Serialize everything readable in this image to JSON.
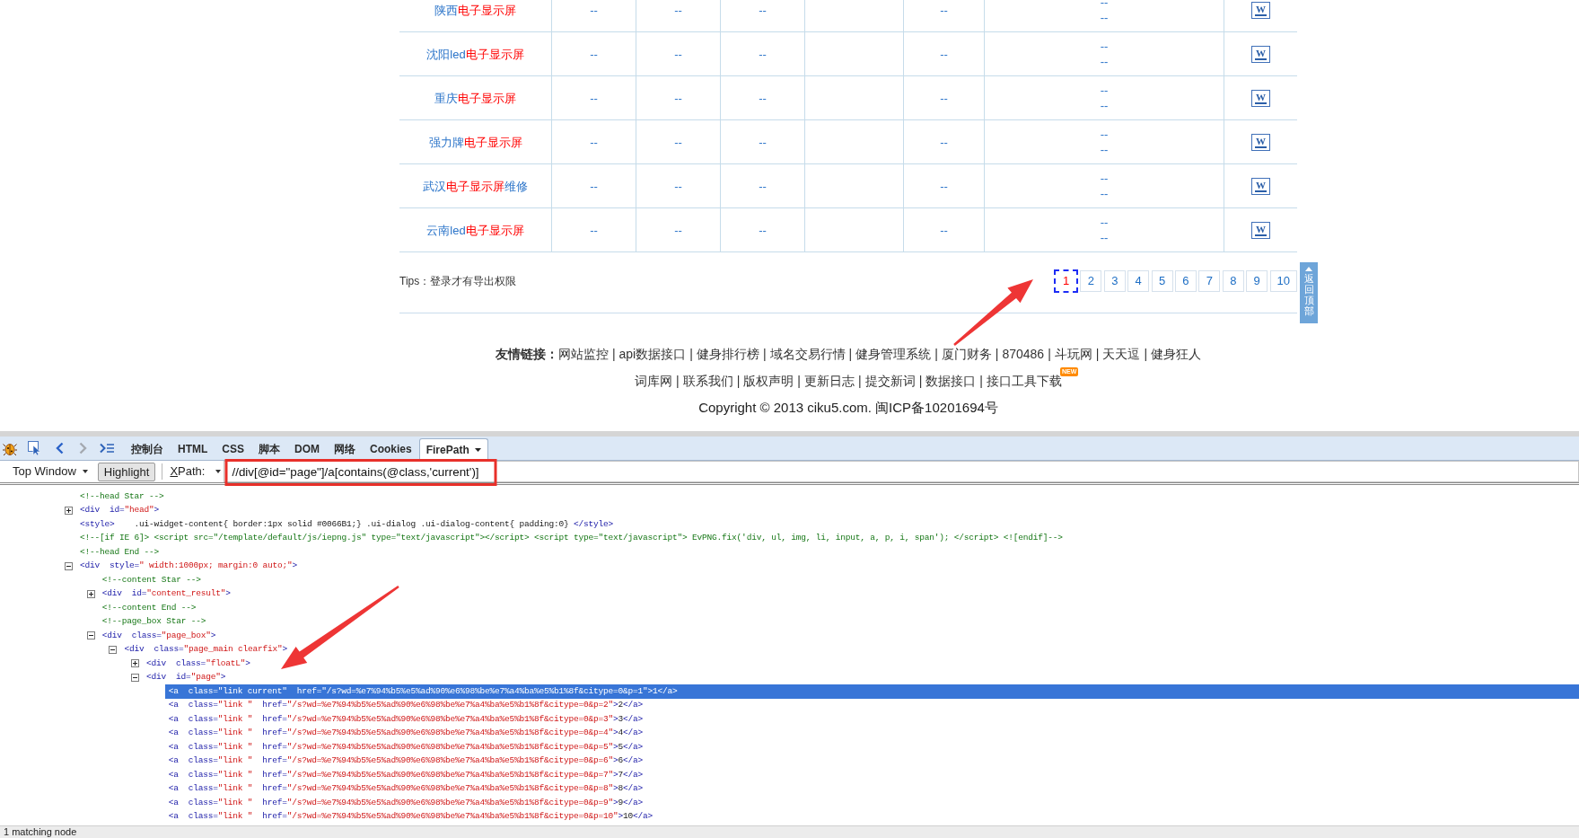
{
  "results_table": {
    "rows": [
      {
        "name": [
          {
            "text": "陕西",
            "highlight": false
          },
          {
            "text": "电子显示屏",
            "highlight": true
          }
        ],
        "column_2": "--",
        "column_3": "--",
        "column_4": "--",
        "column_6": "--",
        "column_7": [
          "--",
          "--"
        ],
        "column_8": "W"
      },
      {
        "name": [
          {
            "text": "沈阳led",
            "highlight": false
          },
          {
            "text": "电子显示屏",
            "highlight": true
          }
        ],
        "column_2": "--",
        "column_3": "--",
        "column_4": "--",
        "column_6": "--",
        "column_7": [
          "--",
          "--"
        ],
        "column_8": "W"
      },
      {
        "name": [
          {
            "text": "重庆",
            "highlight": false
          },
          {
            "text": "电子显示屏",
            "highlight": true
          }
        ],
        "column_2": "--",
        "column_3": "--",
        "column_4": "--",
        "column_6": "--",
        "column_7": [
          "--",
          "--"
        ],
        "column_8": "W"
      },
      {
        "name": [
          {
            "text": "强力牌",
            "highlight": false
          },
          {
            "text": "电子显示屏",
            "highlight": true
          }
        ],
        "column_2": "--",
        "column_3": "--",
        "column_4": "--",
        "column_6": "--",
        "column_7": [
          "--",
          "--"
        ],
        "column_8": "W"
      },
      {
        "name": [
          {
            "text": "武汉",
            "highlight": false
          },
          {
            "text": "电子显示屏",
            "highlight": true
          },
          {
            "text": "维修",
            "highlight": false
          }
        ],
        "column_2": "--",
        "column_3": "--",
        "column_4": "--",
        "column_6": "--",
        "column_7": [
          "--",
          "--"
        ],
        "column_8": "W"
      },
      {
        "name": [
          {
            "text": "云南led",
            "highlight": false
          },
          {
            "text": "电子显示屏",
            "highlight": true
          }
        ],
        "column_2": "--",
        "column_3": "--",
        "column_4": "--",
        "column_6": "--",
        "column_7": [
          "--",
          "--"
        ],
        "column_8": "W"
      }
    ]
  },
  "tips": "Tips：登录才有导出权限",
  "pagination": [
    {
      "label": "1",
      "selected": true
    },
    {
      "label": "2",
      "selected": false
    },
    {
      "label": "3",
      "selected": false
    },
    {
      "label": "4",
      "selected": false
    },
    {
      "label": "5",
      "selected": false
    },
    {
      "label": "6",
      "selected": false
    },
    {
      "label": "7",
      "selected": false
    },
    {
      "label": "8",
      "selected": false
    },
    {
      "label": "9",
      "selected": false
    },
    {
      "label": "10",
      "selected": false
    }
  ],
  "back_to_top": "返回顶部",
  "footer": {
    "links_label": "友情链接：",
    "link_rows": [
      [
        {
          "label": "网站监控",
          "separator": "|"
        },
        {
          "label": "api数据接口",
          "separator": "|"
        },
        {
          "label": "健身排行榜",
          "separator": "|"
        },
        {
          "label": "域名交易行情",
          "separator": "|"
        },
        {
          "label": "健身管理系统",
          "separator": "|"
        },
        {
          "label": "厦门财务",
          "separator": "|"
        },
        {
          "label": "870486",
          "separator": "|"
        },
        {
          "label": "斗玩网",
          "separator": "|"
        },
        {
          "label": "天天逗",
          "separator": "|"
        },
        {
          "label": "健身狂人"
        }
      ],
      [
        {
          "label": "词库网",
          "separator": "|"
        },
        {
          "label": "联系我们",
          "separator": "|"
        },
        {
          "label": "版权声明",
          "separator": "|"
        },
        {
          "label": "更新日志",
          "separator": "|"
        },
        {
          "label": "提交新词",
          "separator": "|"
        },
        {
          "label": "数据接口",
          "separator": "|"
        },
        {
          "label": "接口工具下载",
          "badge": "NEW"
        }
      ]
    ],
    "copyright": "Copyright © 2013 ciku5.com. 闽ICP备10201694号"
  },
  "devtools": {
    "history_buttons": [
      {
        "disabled": false
      },
      {
        "disabled": true
      }
    ],
    "tabs": [
      {
        "label": "控制台",
        "selected": false
      },
      {
        "label": "HTML",
        "selected": false
      },
      {
        "label": "CSS",
        "selected": false
      },
      {
        "label": "脚本",
        "selected": false
      },
      {
        "label": "DOM",
        "selected": false
      },
      {
        "label": "网络",
        "selected": false
      },
      {
        "label": "Cookies",
        "selected": false
      },
      {
        "label": "FirePath",
        "selected": true
      }
    ],
    "frame_selector": "Top Window",
    "highlight_button": {
      "label": "Highlight",
      "pressed": true
    },
    "selector_type": "XPath:",
    "xpath_value": "//div[@id=\"page\"]/a[contains(@class,'current')]",
    "html_tree": [
      {
        "kind": "leaf",
        "selected": false,
        "segments": [
          {
            "kind": "comment",
            "text": "<!--head Star -->"
          }
        ]
      },
      {
        "kind": "branch",
        "expanded": false,
        "selected": false,
        "segments": [
          {
            "kind": "tag",
            "text": "<div"
          },
          {
            "kind": "attr",
            "text": "  id="
          },
          {
            "kind": "value",
            "text": "\"head\""
          },
          {
            "kind": "tag",
            "text": ">"
          }
        ]
      },
      {
        "kind": "leaf",
        "selected": false,
        "segments": [
          {
            "kind": "tag",
            "text": "<style>"
          },
          {
            "kind": "text",
            "text": "    .ui-widget-content{ border:1px solid #0066B1;} .ui-dialog .ui-dialog-content{ padding:0} "
          },
          {
            "kind": "tag",
            "text": "</style>"
          }
        ]
      },
      {
        "kind": "leaf",
        "selected": false,
        "segments": [
          {
            "kind": "comment",
            "text": "<!--[if IE 6]> <script src=\"/template/default/js/iepng.js\" type=\"text/javascript\"></script> <script type=\"text/javascript\"> EvPNG.fix('div, ul, img, li, input, a, p, i, span'); </script> <![endif]-->"
          }
        ]
      },
      {
        "kind": "leaf",
        "selected": false,
        "segments": [
          {
            "kind": "comment",
            "text": "<!--head End -->"
          }
        ]
      },
      {
        "kind": "branch",
        "expanded": true,
        "selected": false,
        "segments": [
          {
            "kind": "tag",
            "text": "<div"
          },
          {
            "kind": "attr",
            "text": "  style="
          },
          {
            "kind": "value",
            "text": "\" width:1000px; margin:0 auto;\""
          },
          {
            "kind": "tag",
            "text": ">"
          }
        ],
        "children": [
          {
            "kind": "leaf",
            "selected": false,
            "segments": [
              {
                "kind": "comment",
                "text": "<!--content Star -->"
              }
            ]
          },
          {
            "kind": "branch",
            "expanded": false,
            "selected": false,
            "segments": [
              {
                "kind": "tag",
                "text": "<div"
              },
              {
                "kind": "attr",
                "text": "  id="
              },
              {
                "kind": "value",
                "text": "\"content_result\""
              },
              {
                "kind": "tag",
                "text": ">"
              }
            ]
          },
          {
            "kind": "leaf",
            "selected": false,
            "segments": [
              {
                "kind": "comment",
                "text": "<!--content End -->"
              }
            ]
          },
          {
            "kind": "leaf",
            "selected": false,
            "segments": [
              {
                "kind": "comment",
                "text": "<!--page_box Star -->"
              }
            ]
          },
          {
            "kind": "branch",
            "expanded": true,
            "selected": false,
            "segments": [
              {
                "kind": "tag",
                "text": "<div"
              },
              {
                "kind": "attr",
                "text": "  class="
              },
              {
                "kind": "value",
                "text": "\"page_box\""
              },
              {
                "kind": "tag",
                "text": ">"
              }
            ],
            "children": [
              {
                "kind": "branch",
                "expanded": true,
                "selected": false,
                "segments": [
                  {
                    "kind": "tag",
                    "text": "<div"
                  },
                  {
                    "kind": "attr",
                    "text": "  class="
                  },
                  {
                    "kind": "value",
                    "text": "\"page_main clearfix\""
                  },
                  {
                    "kind": "tag",
                    "text": ">"
                  }
                ],
                "children": [
                  {
                    "kind": "branch",
                    "expanded": false,
                    "selected": false,
                    "segments": [
                      {
                        "kind": "tag",
                        "text": "<div"
                      },
                      {
                        "kind": "attr",
                        "text": "  class="
                      },
                      {
                        "kind": "value",
                        "text": "\"floatL\""
                      },
                      {
                        "kind": "tag",
                        "text": ">"
                      }
                    ]
                  },
                  {
                    "kind": "branch",
                    "expanded": true,
                    "selected": false,
                    "segments": [
                      {
                        "kind": "tag",
                        "text": "<div"
                      },
                      {
                        "kind": "attr",
                        "text": "  id="
                      },
                      {
                        "kind": "value",
                        "text": "\"page\""
                      },
                      {
                        "kind": "tag",
                        "text": ">"
                      }
                    ],
                    "children": [
                      {
                        "kind": "leaf",
                        "selected": true,
                        "segments": [
                          {
                            "kind": "tag",
                            "text": "<a"
                          },
                          {
                            "kind": "attr",
                            "text": "  class="
                          },
                          {
                            "kind": "value",
                            "text": "\"link current\""
                          },
                          {
                            "kind": "attr",
                            "text": "  href="
                          },
                          {
                            "kind": "value",
                            "text": "\"/s?wd=%e7%94%b5%e5%ad%90%e6%98%be%e7%a4%ba%e5%b1%8f&citype=0&p=1\""
                          },
                          {
                            "kind": "tag",
                            "text": ">"
                          },
                          {
                            "kind": "text",
                            "text": "1"
                          },
                          {
                            "kind": "tag",
                            "text": "</a>"
                          }
                        ]
                      },
                      {
                        "kind": "leaf",
                        "selected": false,
                        "segments": [
                          {
                            "kind": "tag",
                            "text": "<a"
                          },
                          {
                            "kind": "attr",
                            "text": "  class="
                          },
                          {
                            "kind": "value",
                            "text": "\"link \""
                          },
                          {
                            "kind": "attr",
                            "text": "  href="
                          },
                          {
                            "kind": "value",
                            "text": "\"/s?wd=%e7%94%b5%e5%ad%90%e6%98%be%e7%a4%ba%e5%b1%8f&citype=0&p=2\""
                          },
                          {
                            "kind": "tag",
                            "text": ">"
                          },
                          {
                            "kind": "text",
                            "text": "2"
                          },
                          {
                            "kind": "tag",
                            "text": "</a>"
                          }
                        ]
                      },
                      {
                        "kind": "leaf",
                        "selected": false,
                        "segments": [
                          {
                            "kind": "tag",
                            "text": "<a"
                          },
                          {
                            "kind": "attr",
                            "text": "  class="
                          },
                          {
                            "kind": "value",
                            "text": "\"link \""
                          },
                          {
                            "kind": "attr",
                            "text": "  href="
                          },
                          {
                            "kind": "value",
                            "text": "\"/s?wd=%e7%94%b5%e5%ad%90%e6%98%be%e7%a4%ba%e5%b1%8f&citype=0&p=3\""
                          },
                          {
                            "kind": "tag",
                            "text": ">"
                          },
                          {
                            "kind": "text",
                            "text": "3"
                          },
                          {
                            "kind": "tag",
                            "text": "</a>"
                          }
                        ]
                      },
                      {
                        "kind": "leaf",
                        "selected": false,
                        "segments": [
                          {
                            "kind": "tag",
                            "text": "<a"
                          },
                          {
                            "kind": "attr",
                            "text": "  class="
                          },
                          {
                            "kind": "value",
                            "text": "\"link \""
                          },
                          {
                            "kind": "attr",
                            "text": "  href="
                          },
                          {
                            "kind": "value",
                            "text": "\"/s?wd=%e7%94%b5%e5%ad%90%e6%98%be%e7%a4%ba%e5%b1%8f&citype=0&p=4\""
                          },
                          {
                            "kind": "tag",
                            "text": ">"
                          },
                          {
                            "kind": "text",
                            "text": "4"
                          },
                          {
                            "kind": "tag",
                            "text": "</a>"
                          }
                        ]
                      },
                      {
                        "kind": "leaf",
                        "selected": false,
                        "segments": [
                          {
                            "kind": "tag",
                            "text": "<a"
                          },
                          {
                            "kind": "attr",
                            "text": "  class="
                          },
                          {
                            "kind": "value",
                            "text": "\"link \""
                          },
                          {
                            "kind": "attr",
                            "text": "  href="
                          },
                          {
                            "kind": "value",
                            "text": "\"/s?wd=%e7%94%b5%e5%ad%90%e6%98%be%e7%a4%ba%e5%b1%8f&citype=0&p=5\""
                          },
                          {
                            "kind": "tag",
                            "text": ">"
                          },
                          {
                            "kind": "text",
                            "text": "5"
                          },
                          {
                            "kind": "tag",
                            "text": "</a>"
                          }
                        ]
                      },
                      {
                        "kind": "leaf",
                        "selected": false,
                        "segments": [
                          {
                            "kind": "tag",
                            "text": "<a"
                          },
                          {
                            "kind": "attr",
                            "text": "  class="
                          },
                          {
                            "kind": "value",
                            "text": "\"link \""
                          },
                          {
                            "kind": "attr",
                            "text": "  href="
                          },
                          {
                            "kind": "value",
                            "text": "\"/s?wd=%e7%94%b5%e5%ad%90%e6%98%be%e7%a4%ba%e5%b1%8f&citype=0&p=6\""
                          },
                          {
                            "kind": "tag",
                            "text": ">"
                          },
                          {
                            "kind": "text",
                            "text": "6"
                          },
                          {
                            "kind": "tag",
                            "text": "</a>"
                          }
                        ]
                      },
                      {
                        "kind": "leaf",
                        "selected": false,
                        "segments": [
                          {
                            "kind": "tag",
                            "text": "<a"
                          },
                          {
                            "kind": "attr",
                            "text": "  class="
                          },
                          {
                            "kind": "value",
                            "text": "\"link \""
                          },
                          {
                            "kind": "attr",
                            "text": "  href="
                          },
                          {
                            "kind": "value",
                            "text": "\"/s?wd=%e7%94%b5%e5%ad%90%e6%98%be%e7%a4%ba%e5%b1%8f&citype=0&p=7\""
                          },
                          {
                            "kind": "tag",
                            "text": ">"
                          },
                          {
                            "kind": "text",
                            "text": "7"
                          },
                          {
                            "kind": "tag",
                            "text": "</a>"
                          }
                        ]
                      },
                      {
                        "kind": "leaf",
                        "selected": false,
                        "segments": [
                          {
                            "kind": "tag",
                            "text": "<a"
                          },
                          {
                            "kind": "attr",
                            "text": "  class="
                          },
                          {
                            "kind": "value",
                            "text": "\"link \""
                          },
                          {
                            "kind": "attr",
                            "text": "  href="
                          },
                          {
                            "kind": "value",
                            "text": "\"/s?wd=%e7%94%b5%e5%ad%90%e6%98%be%e7%a4%ba%e5%b1%8f&citype=0&p=8\""
                          },
                          {
                            "kind": "tag",
                            "text": ">"
                          },
                          {
                            "kind": "text",
                            "text": "8"
                          },
                          {
                            "kind": "tag",
                            "text": "</a>"
                          }
                        ]
                      },
                      {
                        "kind": "leaf",
                        "selected": false,
                        "segments": [
                          {
                            "kind": "tag",
                            "text": "<a"
                          },
                          {
                            "kind": "attr",
                            "text": "  class="
                          },
                          {
                            "kind": "value",
                            "text": "\"link \""
                          },
                          {
                            "kind": "attr",
                            "text": "  href="
                          },
                          {
                            "kind": "value",
                            "text": "\"/s?wd=%e7%94%b5%e5%ad%90%e6%98%be%e7%a4%ba%e5%b1%8f&citype=0&p=9\""
                          },
                          {
                            "kind": "tag",
                            "text": ">"
                          },
                          {
                            "kind": "text",
                            "text": "9"
                          },
                          {
                            "kind": "tag",
                            "text": "</a>"
                          }
                        ]
                      },
                      {
                        "kind": "leaf",
                        "selected": false,
                        "segments": [
                          {
                            "kind": "tag",
                            "text": "<a"
                          },
                          {
                            "kind": "attr",
                            "text": "  class="
                          },
                          {
                            "kind": "value",
                            "text": "\"link \""
                          },
                          {
                            "kind": "attr",
                            "text": "  href="
                          },
                          {
                            "kind": "value",
                            "text": "\"/s?wd=%e7%94%b5%e5%ad%90%e6%98%be%e7%a4%ba%e5%b1%8f&citype=0&p=10\""
                          },
                          {
                            "kind": "tag",
                            "text": ">"
                          },
                          {
                            "kind": "text",
                            "text": "10"
                          },
                          {
                            "kind": "tag",
                            "text": "</a>"
                          }
                        ]
                      }
                    ]
                  }
                ]
              }
            ]
          }
        ]
      }
    ],
    "status": "1 matching node"
  }
}
